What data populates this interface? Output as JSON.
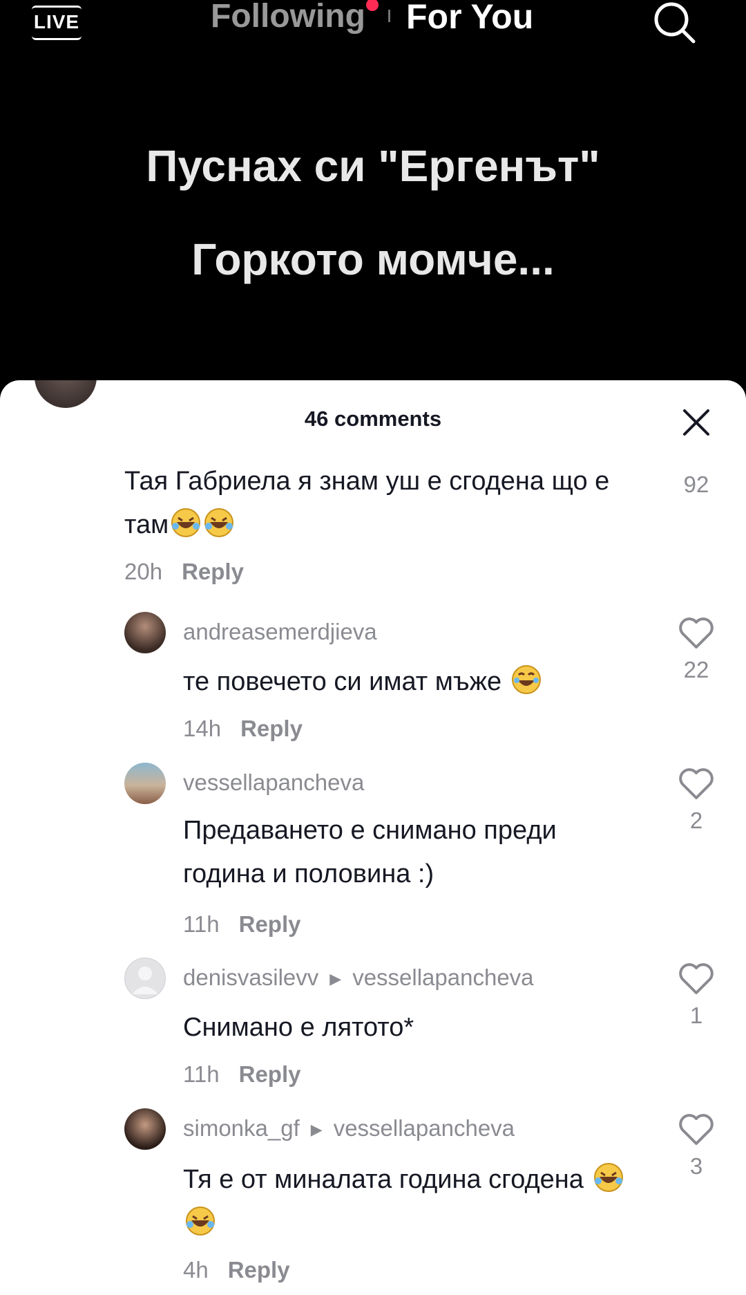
{
  "topbar": {
    "live_label": "LIVE",
    "following_label": "Following",
    "foryou_label": "For You"
  },
  "video": {
    "caption_line1": "Пуснах си \"Ергенът\"",
    "caption_line2": "Горкото момче..."
  },
  "comments_panel": {
    "title": "46 comments",
    "comments": [
      {
        "text": "Тая Габриела я знам уш е сгодена що е там",
        "time": "20h",
        "reply_label": "Reply",
        "likes": "92"
      },
      {
        "username": "andreasemerdjieva",
        "text": "те повечето си имат мъже",
        "time": "14h",
        "reply_label": "Reply",
        "likes": "22"
      },
      {
        "username": "vessellapancheva",
        "text": "Предаването е снимано преди година и половина :)",
        "time": "11h",
        "reply_label": "Reply",
        "likes": "2"
      },
      {
        "username": "denisvasilevv",
        "reply_to": "vessellapancheva",
        "text": "Снимано е лятото*",
        "time": "11h",
        "reply_label": "Reply",
        "likes": "1"
      },
      {
        "username": "simonka_gf",
        "reply_to": "vessellapancheva",
        "text": "Тя е от миналата година сгодена",
        "time": "4h",
        "reply_label": "Reply",
        "likes": "3"
      }
    ]
  },
  "colors": {
    "accent_dot": "#fe2c55",
    "secondary_text": "#8a8b91",
    "primary_text": "#161823"
  }
}
